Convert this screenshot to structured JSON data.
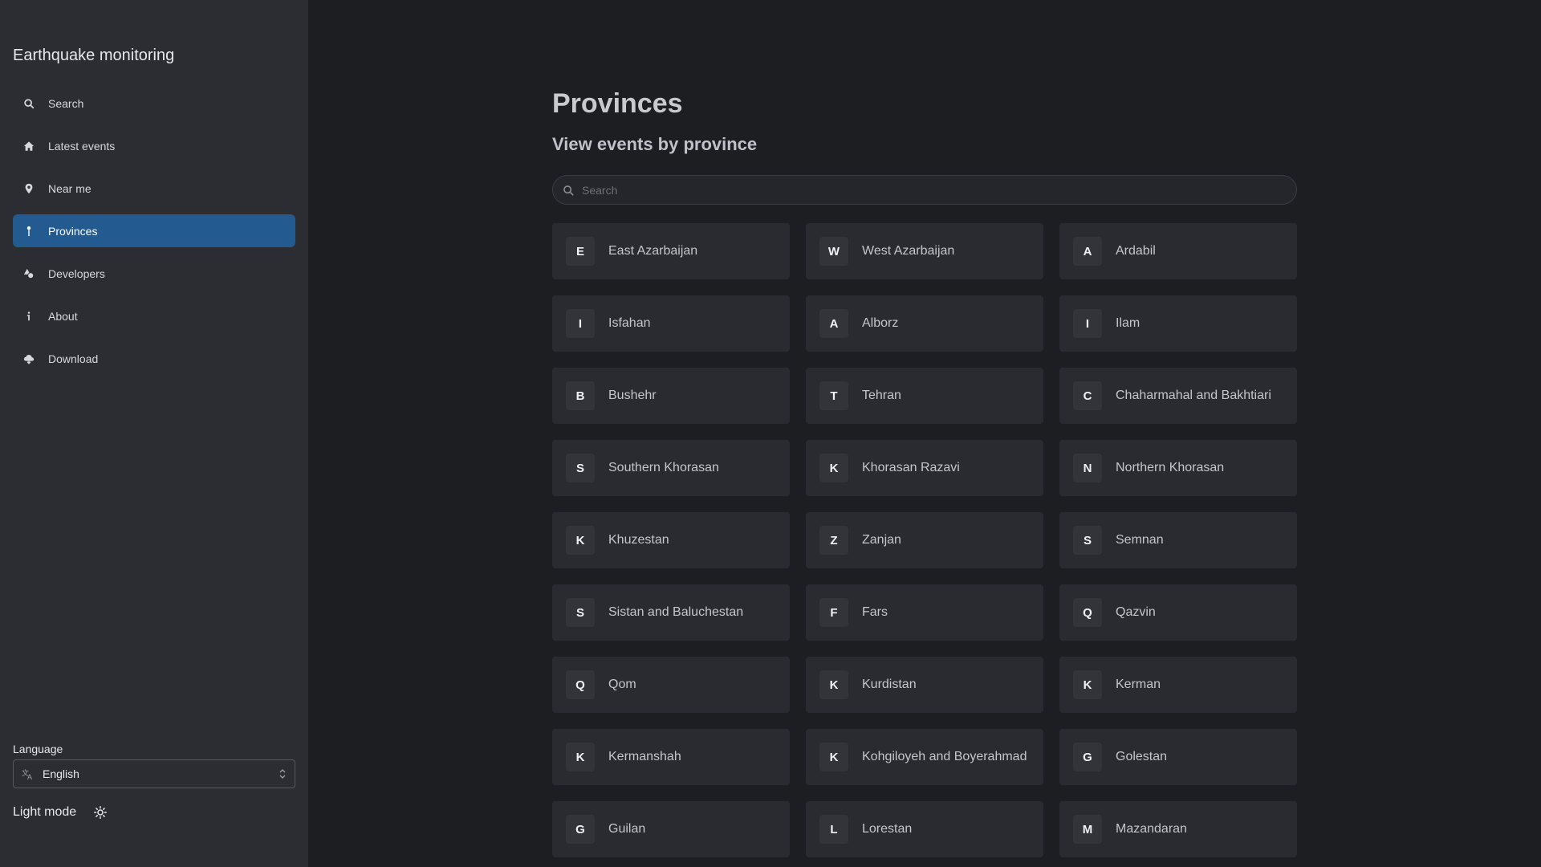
{
  "sidebar": {
    "title": "Earthquake monitoring",
    "items": [
      {
        "label": "Search",
        "icon": "search-icon",
        "active": false
      },
      {
        "label": "Latest events",
        "icon": "home-icon",
        "active": false
      },
      {
        "label": "Near me",
        "icon": "location-pin-icon",
        "active": false
      },
      {
        "label": "Provinces",
        "icon": "map-pin-icon",
        "active": true
      },
      {
        "label": "Developers",
        "icon": "shapes-icon",
        "active": false
      },
      {
        "label": "About",
        "icon": "info-icon",
        "active": false
      },
      {
        "label": "Download",
        "icon": "cloud-download-icon",
        "active": false
      }
    ],
    "language_label": "Language",
    "language_value": "English",
    "theme_label": "Light mode"
  },
  "main": {
    "title": "Provinces",
    "subtitle": "View events by province",
    "search_placeholder": "Search",
    "provinces": [
      {
        "letter": "E",
        "name": "East Azarbaijan"
      },
      {
        "letter": "W",
        "name": "West Azarbaijan"
      },
      {
        "letter": "A",
        "name": "Ardabil"
      },
      {
        "letter": "I",
        "name": "Isfahan"
      },
      {
        "letter": "A",
        "name": "Alborz"
      },
      {
        "letter": "I",
        "name": "Ilam"
      },
      {
        "letter": "B",
        "name": "Bushehr"
      },
      {
        "letter": "T",
        "name": "Tehran"
      },
      {
        "letter": "C",
        "name": "Chaharmahal and Bakhtiari"
      },
      {
        "letter": "S",
        "name": "Southern Khorasan"
      },
      {
        "letter": "K",
        "name": "Khorasan Razavi"
      },
      {
        "letter": "N",
        "name": "Northern Khorasan"
      },
      {
        "letter": "K",
        "name": "Khuzestan"
      },
      {
        "letter": "Z",
        "name": "Zanjan"
      },
      {
        "letter": "S",
        "name": "Semnan"
      },
      {
        "letter": "S",
        "name": "Sistan and Baluchestan"
      },
      {
        "letter": "F",
        "name": "Fars"
      },
      {
        "letter": "Q",
        "name": "Qazvin"
      },
      {
        "letter": "Q",
        "name": "Qom"
      },
      {
        "letter": "K",
        "name": "Kurdistan"
      },
      {
        "letter": "K",
        "name": "Kerman"
      },
      {
        "letter": "K",
        "name": "Kermanshah"
      },
      {
        "letter": "K",
        "name": "Kohgiloyeh and Boyerahmad"
      },
      {
        "letter": "G",
        "name": "Golestan"
      },
      {
        "letter": "G",
        "name": "Guilan"
      },
      {
        "letter": "L",
        "name": "Lorestan"
      },
      {
        "letter": "M",
        "name": "Mazandaran"
      }
    ]
  },
  "colors": {
    "sidebar_bg": "#2c2d32",
    "main_bg": "#1d1e22",
    "active_item": "#235a8f",
    "card_bg": "#2a2b30"
  }
}
